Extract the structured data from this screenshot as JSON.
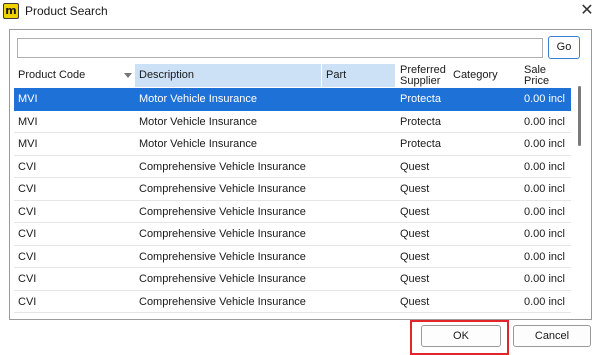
{
  "window": {
    "icon_letter": "m",
    "title": "Product Search",
    "close_glyph": "✕"
  },
  "search": {
    "value": "",
    "placeholder": "",
    "go_label": "Go"
  },
  "table": {
    "columns": [
      {
        "label": "Product Code"
      },
      {
        "label": "Description"
      },
      {
        "label": "Part"
      },
      {
        "label": "Preferred Supplier"
      },
      {
        "label": "Category"
      },
      {
        "label": "Sale Price"
      }
    ],
    "rows": [
      {
        "code": "MVI",
        "description": "Motor Vehicle Insurance",
        "part": "",
        "supplier": "Protecta",
        "category": "",
        "price": "0.00 incl"
      },
      {
        "code": "MVI",
        "description": "Motor Vehicle Insurance",
        "part": "",
        "supplier": "Protecta",
        "category": "",
        "price": "0.00 incl"
      },
      {
        "code": "MVI",
        "description": "Motor Vehicle Insurance",
        "part": "",
        "supplier": "Protecta",
        "category": "",
        "price": "0.00 incl"
      },
      {
        "code": "CVI",
        "description": "Comprehensive Vehicle Insurance",
        "part": "",
        "supplier": "Quest",
        "category": "",
        "price": "0.00 incl"
      },
      {
        "code": "CVI",
        "description": "Comprehensive Vehicle Insurance",
        "part": "",
        "supplier": "Quest",
        "category": "",
        "price": "0.00 incl"
      },
      {
        "code": "CVI",
        "description": "Comprehensive Vehicle Insurance",
        "part": "",
        "supplier": "Quest",
        "category": "",
        "price": "0.00 incl"
      },
      {
        "code": "CVI",
        "description": "Comprehensive Vehicle Insurance",
        "part": "",
        "supplier": "Quest",
        "category": "",
        "price": "0.00 incl"
      },
      {
        "code": "CVI",
        "description": "Comprehensive Vehicle Insurance",
        "part": "",
        "supplier": "Quest",
        "category": "",
        "price": "0.00 incl"
      },
      {
        "code": "CVI",
        "description": "Comprehensive Vehicle Insurance",
        "part": "",
        "supplier": "Quest",
        "category": "",
        "price": "0.00 incl"
      },
      {
        "code": "CVI",
        "description": "Comprehensive Vehicle Insurance",
        "part": "",
        "supplier": "Quest",
        "category": "",
        "price": "0.00 incl"
      }
    ],
    "selected_row": 0,
    "sorted_column": "Product Code",
    "highlighted_column": "Description"
  },
  "footer": {
    "ok_label": "OK",
    "cancel_label": "Cancel"
  },
  "colors": {
    "selection": "#1e71d6",
    "column_highlight": "#cce1f5",
    "go_border": "#3c7fd0",
    "annotation_red": "#e0262a",
    "app_icon": "#f0d200"
  }
}
